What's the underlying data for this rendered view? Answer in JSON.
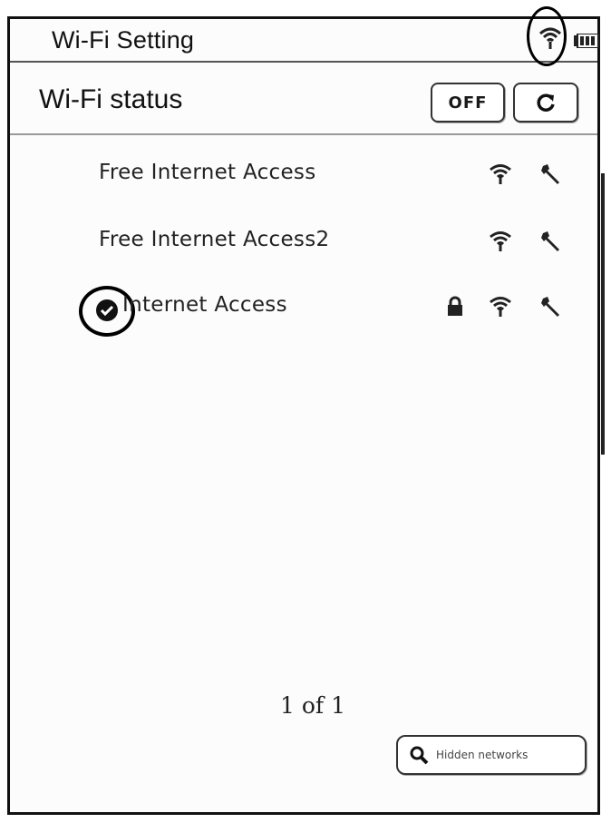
{
  "header": {
    "title": "Wi-Fi Setting",
    "wifi_icon": "wifi-signal-icon",
    "battery_icon": "battery-icon"
  },
  "status": {
    "title": "Wi-Fi status",
    "off_label": "OFF",
    "refresh_icon": "refresh-icon"
  },
  "networks": [
    {
      "name": "Free Internet Access",
      "secured": false,
      "connected": false
    },
    {
      "name": "Free Internet Access2",
      "secured": false,
      "connected": false
    },
    {
      "name": "Internet Access",
      "secured": true,
      "connected": true
    }
  ],
  "pager": {
    "text": "1 of 1"
  },
  "hidden_networks": {
    "label": "Hidden networks",
    "icon": "search-icon"
  },
  "colors": {
    "ink": "#111111",
    "background": "#fcfcfc"
  }
}
